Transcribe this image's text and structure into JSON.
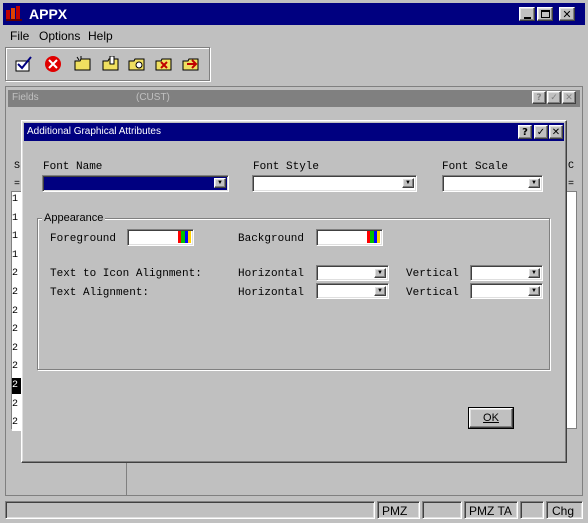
{
  "app": {
    "title": "APPX",
    "icon": "appx-logo-icon"
  },
  "menu": {
    "items": [
      {
        "label": "File",
        "underline": "F"
      },
      {
        "label": "Options",
        "underline": "O"
      },
      {
        "label": "Help",
        "underline": "H"
      }
    ]
  },
  "toolbar": {
    "buttons": [
      {
        "name": "ok-check-icon"
      },
      {
        "name": "cancel-icon"
      },
      {
        "name": "add-record-icon"
      },
      {
        "name": "change-record-icon"
      },
      {
        "name": "inquire-record-icon"
      },
      {
        "name": "delete-record-icon"
      },
      {
        "name": "scan-record-icon"
      }
    ]
  },
  "fields_window": {
    "title": "Fields",
    "subtitle": "(CUST)",
    "column_left": "S",
    "column_right": "C",
    "row_values": [
      "1",
      "1",
      "1",
      "1",
      "2",
      "2",
      "2",
      "2",
      "2",
      "2",
      "2",
      "2",
      "2"
    ]
  },
  "dialog": {
    "title": "Additional Graphical Attributes",
    "font_name_label": "Font Name",
    "font_style_label": "Font Style",
    "font_scale_label": "Font Scale",
    "font_name_value": "",
    "font_style_value": "",
    "font_scale_value": "",
    "appearance_label": "Appearance",
    "foreground_label": "Foreground",
    "background_label": "Background",
    "text_icon_alignment_label": "Text to Icon Alignment:",
    "text_alignment_label": "Text Alignment:",
    "horizontal_label": "Horizontal",
    "vertical_label": "Vertical",
    "ok_label": "OK"
  },
  "status_bar": {
    "cells": [
      "PMZ",
      "PMZ TA",
      "Chg"
    ]
  },
  "colors": {
    "title_active": "#000080",
    "title_inactive": "#808080",
    "face": "#c0c0c0"
  }
}
